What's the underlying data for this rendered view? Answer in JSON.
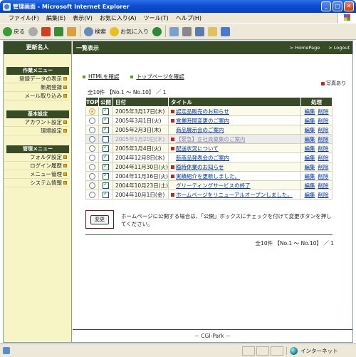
{
  "window": {
    "title": "管理画面 - Microsoft Internet Explorer"
  },
  "menu": [
    "ファイル(F)",
    "編集(E)",
    "表示(V)",
    "お気に入り(A)",
    "ツール(T)",
    "ヘルプ(H)"
  ],
  "toolbar": {
    "back": "戻る",
    "search": "検索",
    "favorites": "お気に入り"
  },
  "sidebar": {
    "header": "更新名人",
    "sections": [
      {
        "title": "作業メニュー",
        "items": [
          "登録データの表示",
          "新規登録",
          "メール取り込み"
        ]
      },
      {
        "title": "基本設定",
        "items": [
          "アカウント設定",
          "環境設定"
        ]
      },
      {
        "title": "管理メニュー",
        "items": [
          "フォルダ設定",
          "ログイン履歴",
          "メニュー管理",
          "システム情報"
        ]
      }
    ]
  },
  "main": {
    "title": "一覧表示",
    "top_links": [
      "> HomePage",
      "> Logout"
    ],
    "quick_links": [
      "HTMLを確認",
      "トップページを確認"
    ],
    "photo_note": "写真あり",
    "count_text": "全10件 【No.1 ～ No.10】 ／ 1",
    "columns": [
      "TOP",
      "公開",
      "日付",
      "タイトル",
      "処理"
    ],
    "actions": [
      "編集",
      "削除"
    ],
    "rows": [
      {
        "top": true,
        "public": true,
        "date": "2005年3月17日(木)",
        "title": "認定品販売のお知らせ",
        "photo": true,
        "grey": false
      },
      {
        "top": false,
        "public": true,
        "date": "2005年3月1日(火)",
        "title": "営業時間変更のご案内",
        "photo": true,
        "grey": false
      },
      {
        "top": false,
        "public": true,
        "date": "2005年2月3日(木)",
        "title": "商品展示会のご案内",
        "photo": false,
        "grey": false
      },
      {
        "top": false,
        "public": false,
        "date": "2005年1月20日(木)",
        "title": "【緊急】正社員募集のご案内",
        "photo": true,
        "grey": true
      },
      {
        "top": false,
        "public": true,
        "date": "2005年1月4日(火)",
        "title": "配送状況について",
        "photo": true,
        "grey": false
      },
      {
        "top": false,
        "public": true,
        "date": "2004年12月8日(水)",
        "title": "新商品発表会のご案内",
        "photo": false,
        "grey": false
      },
      {
        "top": false,
        "public": true,
        "date": "2004年11月30日(火)",
        "title": "臨時休業のお知らせ",
        "photo": true,
        "grey": false
      },
      {
        "top": false,
        "public": true,
        "date": "2004年11月16日(火)",
        "title": "実績紹介を更新しました。",
        "photo": true,
        "grey": false
      },
      {
        "top": false,
        "public": true,
        "date": "2004年10月23日(土)",
        "title": "グリーティングサービスの終了",
        "photo": false,
        "grey": false
      },
      {
        "top": false,
        "public": true,
        "date": "2004年10月1日(金)",
        "title": "ホームページをリニューアルオープンしました。",
        "photo": true,
        "grey": false
      }
    ],
    "submit_label": "変更",
    "submit_note": "ホームページに公開する場合は、「公開」ボックスにチェックを付けて変更ボタンを押してください。",
    "footer": "－ CGI-Park －"
  },
  "status": {
    "zone": "インターネット"
  }
}
